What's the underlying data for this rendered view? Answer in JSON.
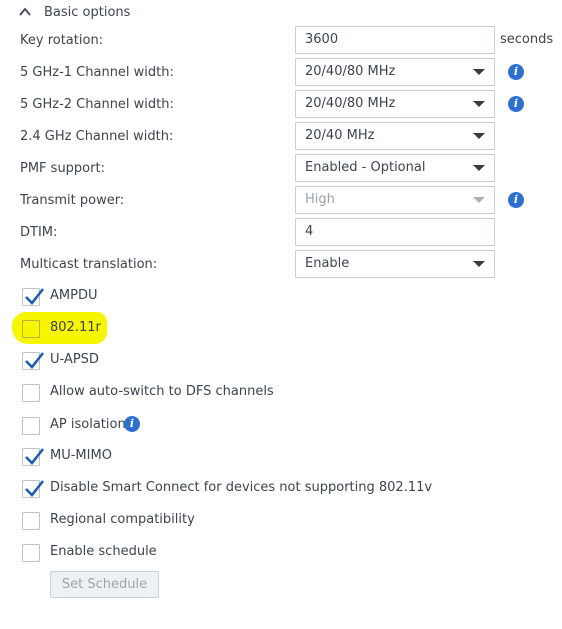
{
  "section": {
    "title": "Basic options"
  },
  "fields": {
    "key_rotation": {
      "label": "Key rotation:",
      "value": "3600",
      "unit": "seconds"
    },
    "ch5g1": {
      "label": "5 GHz-1 Channel width:",
      "value": "20/40/80 MHz"
    },
    "ch5g2": {
      "label": "5 GHz-2 Channel width:",
      "value": "20/40/80 MHz"
    },
    "ch24": {
      "label": "2.4 GHz Channel width:",
      "value": "20/40 MHz"
    },
    "pmf": {
      "label": "PMF support:",
      "value": "Enabled - Optional"
    },
    "tx_power": {
      "label": "Transmit power:",
      "value": "High"
    },
    "dtim": {
      "label": "DTIM:",
      "value": "4"
    },
    "multicast": {
      "label": "Multicast translation:",
      "value": "Enable"
    }
  },
  "checkboxes": {
    "ampdu": {
      "label": "AMPDU",
      "checked": true
    },
    "r80211": {
      "label": "802.11r",
      "checked": false
    },
    "uapsd": {
      "label": "U-APSD",
      "checked": true
    },
    "dfs": {
      "label": "Allow auto-switch to DFS channels",
      "checked": false
    },
    "ap_isolation": {
      "label": "AP isolation",
      "checked": false
    },
    "mumimo": {
      "label": "MU-MIMO",
      "checked": true
    },
    "smart_connect": {
      "label": "Disable Smart Connect for devices not supporting 802.11v",
      "checked": true
    },
    "regional": {
      "label": "Regional compatibility",
      "checked": false
    },
    "schedule": {
      "label": "Enable schedule",
      "checked": false
    }
  },
  "buttons": {
    "set_schedule": "Set Schedule"
  },
  "icons": {
    "info": "i"
  },
  "colors": {
    "accent": "#2f6fd0",
    "check": "#1f5faa",
    "highlight": "#f8f500"
  }
}
